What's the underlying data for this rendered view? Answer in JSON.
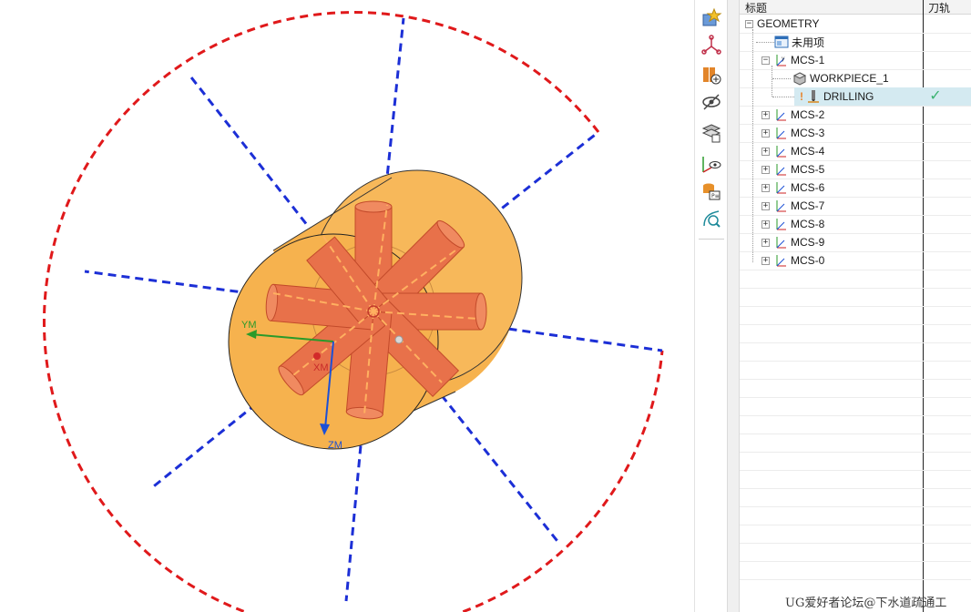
{
  "viewport": {
    "axes": {
      "ym": "YM",
      "xm": "XM",
      "zm": "ZM"
    }
  },
  "resource_bar": {
    "items": [
      {
        "icon": "roles-icon"
      },
      {
        "icon": "assembly-navigator-icon"
      },
      {
        "icon": "reuse-library-icon"
      },
      {
        "icon": "history-hide-icon"
      },
      {
        "icon": "layers-icon"
      },
      {
        "icon": "system-visualization-icon"
      },
      {
        "icon": "machine-library-icon"
      },
      {
        "icon": "process-tool-icon"
      }
    ]
  },
  "navigator": {
    "columns": [
      "标题",
      "刀轨"
    ],
    "nodes": [
      {
        "label": "GEOMETRY",
        "expander": "−",
        "icon": ""
      },
      {
        "label": "未用项",
        "expander": "",
        "icon": "unused-items-icon"
      },
      {
        "label": "MCS-1",
        "expander": "−",
        "icon": "mcs-icon"
      },
      {
        "label": "WORKPIECE_1",
        "expander": "",
        "icon": "workpiece-icon"
      },
      {
        "label": "DRILLING",
        "expander": "",
        "icon": "drilling-operation-icon",
        "selected": true,
        "status": "✓"
      },
      {
        "label": "MCS-2",
        "expander": "+",
        "icon": "mcs-icon"
      },
      {
        "label": "MCS-3",
        "expander": "+",
        "icon": "mcs-icon"
      },
      {
        "label": "MCS-4",
        "expander": "+",
        "icon": "mcs-icon"
      },
      {
        "label": "MCS-5",
        "expander": "+",
        "icon": "mcs-icon"
      },
      {
        "label": "MCS-6",
        "expander": "+",
        "icon": "mcs-icon"
      },
      {
        "label": "MCS-7",
        "expander": "+",
        "icon": "mcs-icon"
      },
      {
        "label": "MCS-8",
        "expander": "+",
        "icon": "mcs-icon"
      },
      {
        "label": "MCS-9",
        "expander": "+",
        "icon": "mcs-icon"
      },
      {
        "label": "MCS-0",
        "expander": "+",
        "icon": "mcs-icon"
      }
    ]
  },
  "watermark": "UG爱好者论坛@下水道疏通工",
  "colors": {
    "boundary_red": "#e0191b",
    "ray_blue": "#1c2fd6",
    "cylinder_fill": "#f6b24e",
    "hole_fill": "#e8714a",
    "selected_row": "#d4eaf1",
    "check": "#3cb371"
  }
}
